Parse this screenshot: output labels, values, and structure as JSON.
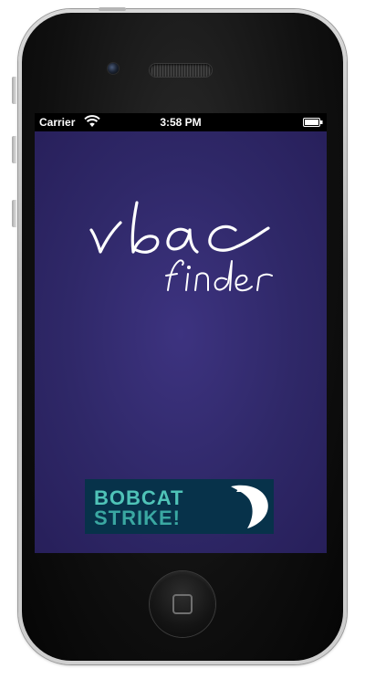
{
  "device": {
    "name": "iPhone 4"
  },
  "status_bar": {
    "carrier": "Carrier",
    "time": "3:58 PM",
    "icons": [
      "wifi-icon",
      "battery-icon"
    ]
  },
  "app": {
    "logo": {
      "line1": "vbac",
      "line2": "finder"
    },
    "background_color": "#2f2868",
    "banner": {
      "line1": "BOBCAT",
      "line2": "STRIKE!",
      "background_color": "#07324a",
      "text_color": "#3fb7b0"
    }
  }
}
